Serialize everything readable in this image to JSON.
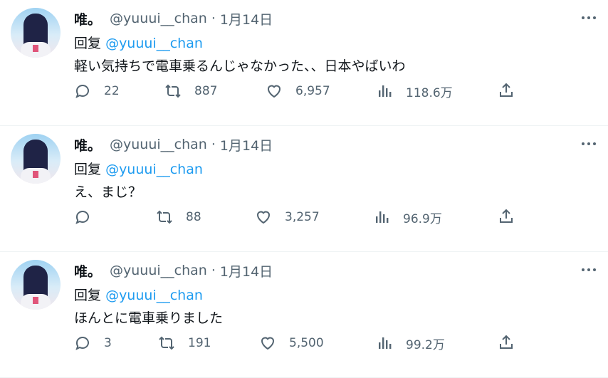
{
  "tweets": [
    {
      "name": "唯。",
      "handle": "@yuuui__chan",
      "sep": "·",
      "date": "1月14日",
      "reply_label": "回复",
      "reply_to": "@yuuui__chan",
      "text": "軽い気持ちで電車乗るんじゃなかった、、日本やばいわ",
      "replies": "22",
      "retweets": "887",
      "likes": "6,957",
      "views": "118.6万"
    },
    {
      "name": "唯。",
      "handle": "@yuuui__chan",
      "sep": "·",
      "date": "1月14日",
      "reply_label": "回复",
      "reply_to": "@yuuui__chan",
      "text": "え、まじ？",
      "replies": "",
      "retweets": "88",
      "likes": "3,257",
      "views": "96.9万"
    },
    {
      "name": "唯。",
      "handle": "@yuuui__chan",
      "sep": "·",
      "date": "1月14日",
      "reply_label": "回复",
      "reply_to": "@yuuui__chan",
      "text": "ほんとに電車乗りました",
      "replies": "3",
      "retweets": "191",
      "likes": "5,500",
      "views": "99.2万"
    }
  ],
  "icons": {
    "more": "more-icon",
    "reply": "reply-icon",
    "retweet": "retweet-icon",
    "like": "like-icon",
    "views": "views-icon",
    "share": "share-icon"
  },
  "colors": {
    "text": "#0f1419",
    "secondary": "#536471",
    "link": "#1d9bf0",
    "divider": "#eff3f4"
  }
}
